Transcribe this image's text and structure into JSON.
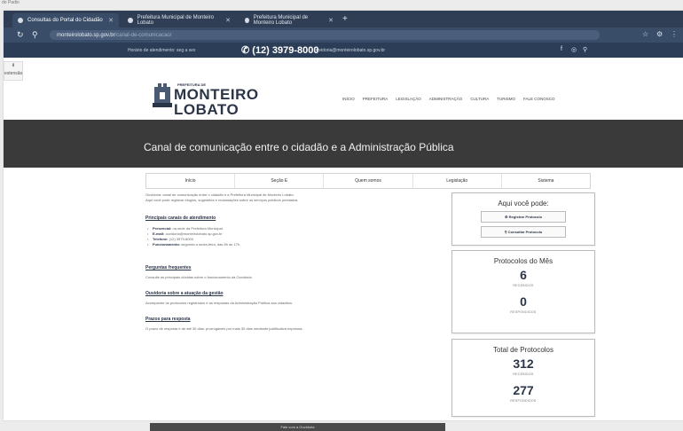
{
  "page_label": "do Padio",
  "browser": {
    "tabs": [
      {
        "title": "Consultas do Portal do Cidadão"
      },
      {
        "title": "Prefeitura Municipal de Monteiro Lobato"
      },
      {
        "title": "Prefeitura Municipal de Monteiro Lobato"
      }
    ],
    "new_tab": "+",
    "url_host": "monteirolobato.sp.gov.br",
    "url_path": "/canal-de-comunicacao/"
  },
  "side_widget": {
    "label": "extensão"
  },
  "contact": {
    "small_text": "Horário de atendimento: seg a sex",
    "phone": "(12) 3979-8000",
    "email": "ouvidoria@monteirolobato.sp.gov.br"
  },
  "logo": {
    "top": "PREFEITURA DE",
    "line1": "MONTEIRO",
    "line2": "LOBATO"
  },
  "nav": [
    "INÍCIO",
    "PREFEITURA",
    "LEGISLAÇÃO",
    "ADMINISTRAÇÃO",
    "CULTURA",
    "TURISMO",
    "FALE CONOSCO"
  ],
  "hero": {
    "title": "Canal de comunicação entre o cidadão e a Administração Pública"
  },
  "content_tabs": [
    "Início",
    "Seção E",
    "Quem somos",
    "Legislação",
    "Sistema"
  ],
  "main": {
    "intro": [
      "Ouvidoria: canal de comunicação entre o cidadão e a Prefeitura Municipal de Monteiro Lobato.",
      "Aqui você pode registrar elogios, sugestões e reclamações sobre os serviços públicos prestados."
    ],
    "section1_title": "Principais canais de atendimento",
    "items": [
      {
        "bold": "Presencial:",
        "text": " na sede da Prefeitura Municipal."
      },
      {
        "bold": "E-mail:",
        "text": " ouvidoria@monteirolobato.sp.gov.br"
      },
      {
        "bold": "Telefone:",
        "text": " (12) 3979-8000"
      },
      {
        "bold": "Funcionamento:",
        "text": " segunda a sexta-feira, das 8h às 17h."
      }
    ],
    "section2_title": "Perguntas frequentes",
    "section2_text": "Consulte as principais dúvidas sobre o funcionamento da Ouvidoria.",
    "section3_title": "Ouvidoria sobre a atuação da gestão",
    "section3_text": "Acompanhe os protocolos registrados e as respostas da Administração Pública aos cidadãos.",
    "section4_title": "Prazos para resposta",
    "section4_text": "O prazo de resposta é de até 30 dias, prorrogáveis por mais 30 dias mediante justificativa expressa.",
    "bottom_bar": "Fale com a Ouvidoria"
  },
  "cards": {
    "aqui": {
      "title": "Aqui você pode:",
      "btn_register": "Registrar Protocolo",
      "btn_consult": "Consultar Protocolo"
    },
    "mes": {
      "title": "Protocolos do Mês",
      "num1": "6",
      "cap1": "RECEBIDOS",
      "num2": "0",
      "cap2": "RESPONDIDOS"
    },
    "total": {
      "title": "Total de Protocolos",
      "num1": "312",
      "cap1": "RECEBIDOS",
      "num2": "277",
      "cap2": "RESPONDIDOS"
    }
  }
}
